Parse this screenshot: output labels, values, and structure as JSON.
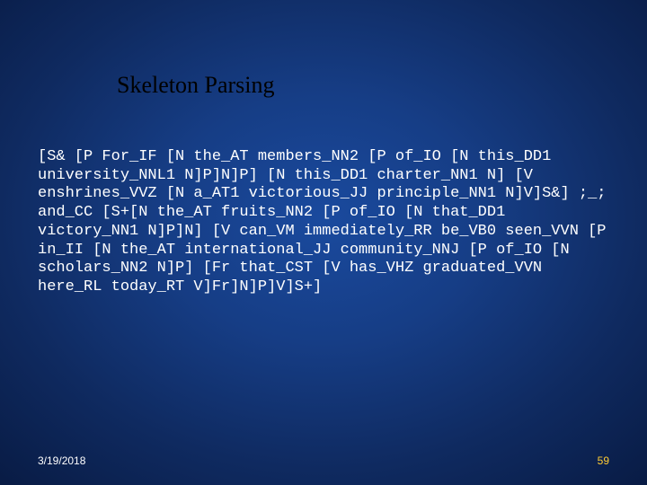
{
  "slide": {
    "title": "Skeleton Parsing",
    "content": "[S& [P For_IF [N the_AT members_NN2 [P of_IO [N this_DD1 university_NNL1 N]P]N]P] [N this_DD1 charter_NN1 N] [V enshrines_VVZ [N a_AT1 victorious_JJ principle_NN1 N]V]S&] ;_; and_CC [S+[N the_AT fruits_NN2 [P of_IO [N that_DD1 victory_NN1 N]P]N] [V can_VM immediately_RR be_VB0 seen_VVN [P in_II [N the_AT international_JJ community_NNJ [P of_IO [N scholars_NN2 N]P] [Fr that_CST [V has_VHZ graduated_VVN here_RL today_RT V]Fr]N]P]V]S+]"
  },
  "footer": {
    "date": "3/19/2018",
    "page": "59"
  }
}
